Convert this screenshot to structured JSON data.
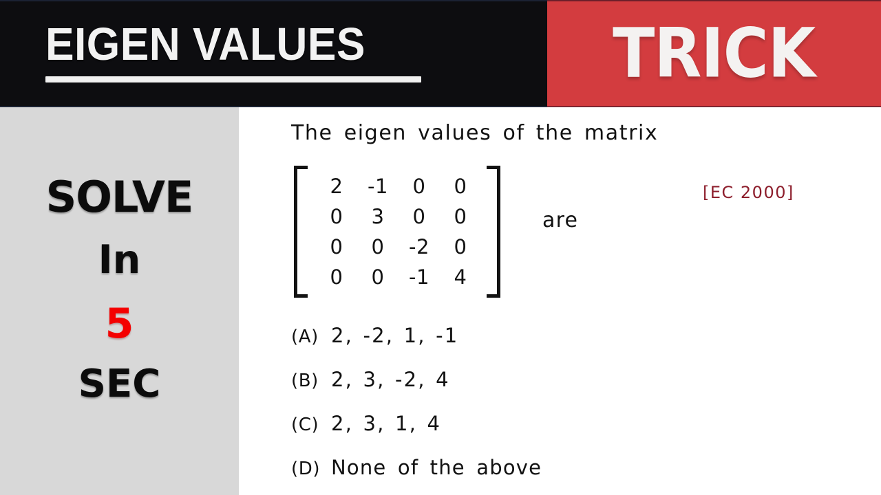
{
  "header": {
    "title": "EIGEN VALUES",
    "badge": "TRICK",
    "black_color": "#0d0d10",
    "red_color": "#d33c3f"
  },
  "sidebar": {
    "background_color": "#d8d8d8",
    "lines": [
      {
        "text": "SOLVE",
        "color": "#0c0c0c"
      },
      {
        "text": "In",
        "color": "#0c0c0c"
      },
      {
        "text": "5",
        "color": "#f40000"
      },
      {
        "text": "SEC",
        "color": "#0c0c0c"
      }
    ]
  },
  "board": {
    "question": "The eigen values of the matrix",
    "are_label": "are",
    "exam_tag": "[EC 2000]",
    "exam_tag_color": "#8d1e2c",
    "matrix": {
      "rows": 4,
      "cols": 4,
      "cells": [
        [
          "2",
          "-1",
          "0",
          "0"
        ],
        [
          "0",
          "3",
          "0",
          "0"
        ],
        [
          "0",
          "0",
          "-2",
          "0"
        ],
        [
          "0",
          "0",
          "-1",
          "4"
        ]
      ]
    },
    "options": [
      {
        "key": "(A)",
        "value": "2, -2, 1, -1"
      },
      {
        "key": "(B)",
        "value": "2, 3, -2, 4"
      },
      {
        "key": "(C)",
        "value": "2, 3, 1, 4"
      },
      {
        "key": "(D)",
        "value": "None of the above"
      }
    ]
  }
}
